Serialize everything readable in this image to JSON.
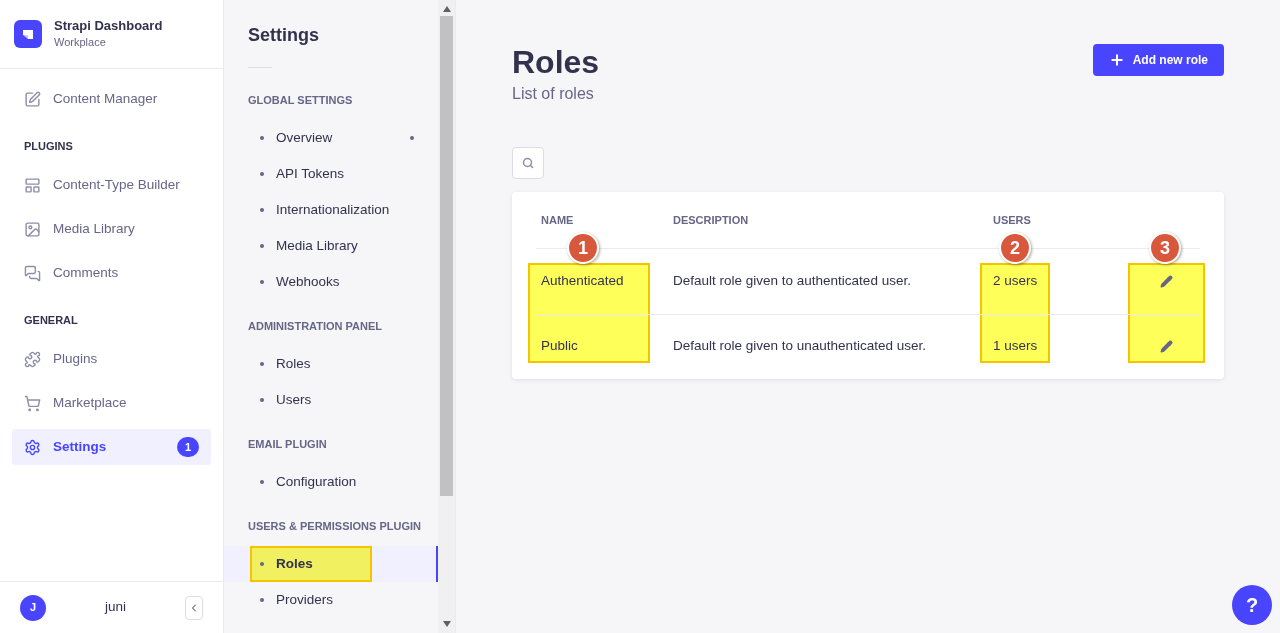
{
  "brand": {
    "title": "Strapi Dashboard",
    "subtitle": "Workplace"
  },
  "nav": [
    {
      "items": [
        {
          "label": "Content Manager",
          "selected": false
        }
      ]
    },
    {
      "heading": "PLUGINS",
      "items": [
        {
          "label": "Content-Type Builder",
          "selected": false
        },
        {
          "label": "Media Library",
          "selected": false
        },
        {
          "label": "Comments",
          "selected": false
        }
      ]
    },
    {
      "heading": "GENERAL",
      "items": [
        {
          "label": "Plugins",
          "selected": false
        },
        {
          "label": "Marketplace",
          "selected": false
        },
        {
          "label": "Settings",
          "selected": true,
          "badge": "1"
        }
      ]
    }
  ],
  "user": {
    "initial": "J",
    "name": "juni"
  },
  "settings_nav": {
    "title": "Settings",
    "sections": [
      {
        "heading": "GLOBAL SETTINGS",
        "items": [
          {
            "label": "Overview",
            "selected": false,
            "dot": true,
            "highlighted": false
          },
          {
            "label": "API Tokens",
            "selected": false,
            "dot": false,
            "highlighted": false
          },
          {
            "label": "Internationalization",
            "selected": false,
            "dot": false,
            "highlighted": false
          },
          {
            "label": "Media Library",
            "selected": false,
            "dot": false,
            "highlighted": false
          },
          {
            "label": "Webhooks",
            "selected": false,
            "dot": false,
            "highlighted": false
          }
        ]
      },
      {
        "heading": "ADMINISTRATION PANEL",
        "items": [
          {
            "label": "Roles",
            "selected": false,
            "dot": false,
            "highlighted": false
          },
          {
            "label": "Users",
            "selected": false,
            "dot": false,
            "highlighted": false
          }
        ]
      },
      {
        "heading": "EMAIL PLUGIN",
        "items": [
          {
            "label": "Configuration",
            "selected": false,
            "dot": false,
            "highlighted": false
          }
        ]
      },
      {
        "heading": "USERS & PERMISSIONS PLUGIN",
        "items": [
          {
            "label": "Roles",
            "selected": true,
            "dot": false,
            "highlighted": true
          },
          {
            "label": "Providers",
            "selected": false,
            "dot": false,
            "highlighted": false
          }
        ]
      }
    ]
  },
  "page": {
    "title": "Roles",
    "subtitle": "List of roles",
    "add_button": "Add new role"
  },
  "table": {
    "columns": [
      {
        "kind": "name",
        "label": "NAME",
        "highlighted": true,
        "marker": "1"
      },
      {
        "kind": "description",
        "label": "DESCRIPTION",
        "highlighted": false
      },
      {
        "kind": "users",
        "label": "USERS",
        "highlighted": true,
        "marker": "2"
      },
      {
        "kind": "actions",
        "highlighted": true,
        "marker": "3"
      }
    ],
    "rows": [
      {
        "name": "Authenticated",
        "description": "Default role given to authenticated user.",
        "users": "2 users"
      },
      {
        "name": "Public",
        "description": "Default role given to unauthenticated user.",
        "users": "1 users"
      }
    ]
  },
  "help_button": "?"
}
